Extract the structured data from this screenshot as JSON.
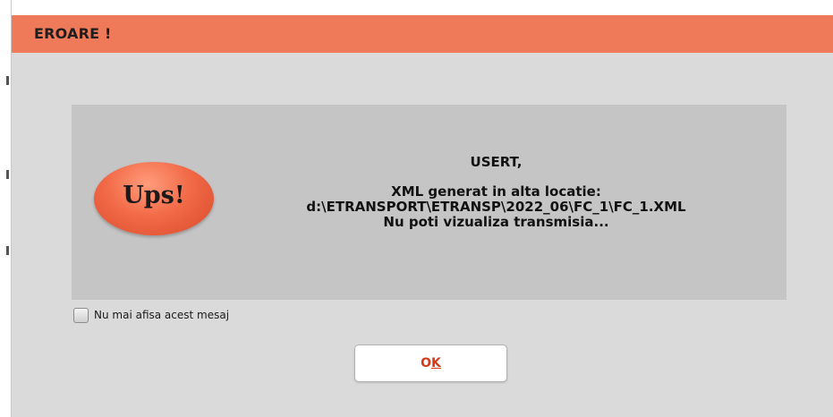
{
  "dialog": {
    "title": "EROARE !",
    "badge_text": "Ups!",
    "message": {
      "greeting": "USERT,",
      "line1": "XML generat in alta locatie:",
      "path": "d:\\ETRANSPORT\\ETRANSP\\2022_06\\FC_1\\FC_1.XML",
      "line3": "Nu poti vizualiza transmisia..."
    },
    "dont_show_label": "Nu mai afisa acest mesaj",
    "dont_show_checked": false,
    "ok_label": {
      "first": "O",
      "underlined": "K"
    }
  },
  "colors": {
    "titlebar": "#ee7a5a",
    "dialog_bg": "#dadada",
    "panel_bg": "#c5c5c5",
    "badge": "#f26a47",
    "ok_text": "#d43a1a"
  },
  "icons": {
    "badge": "ups-badge-icon",
    "checkbox": "checkbox-icon"
  }
}
